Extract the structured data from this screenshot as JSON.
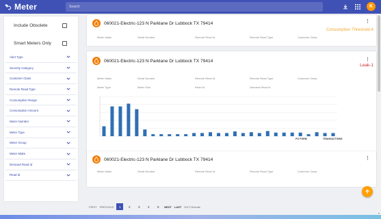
{
  "app": {
    "title": "Meter"
  },
  "search": {
    "placeholder": "Search"
  },
  "header": {
    "avatar_letter": "K"
  },
  "sidebar": {
    "checkboxes": [
      {
        "label": "Include Obsolete",
        "checked": false
      },
      {
        "label": "Smart Meters Only",
        "checked": false
      }
    ],
    "filters": [
      "Alert Type",
      "Severity Category",
      "Customer Class",
      "Remote Read Type",
      "Consumption Range",
      "Consumption Amount",
      "Meter Number",
      "Meter Type",
      "Meter Group",
      "Meter Make",
      "Demand Read Id",
      "Read Id"
    ]
  },
  "cards": [
    {
      "title": "060021-Electric-123 N Parklane Dr Lubbock TX 79414",
      "status": "Consumption Threshold-4",
      "status_color": "#f0a830",
      "fields_row1": [
        "Meter Make",
        "Serial Number",
        "Remote Read Id",
        "Remote Read Type",
        "Customer Class"
      ]
    },
    {
      "title": "060021-Electric-123 N Parklane Dr Lubbock TX 79414",
      "status": "Leak-1",
      "status_color": "#c62828",
      "fields_row1": [
        "Meter Make",
        "Serial Number",
        "Remote Read Id",
        "Remote Read Type",
        "Customer Class"
      ],
      "fields_row2": [
        "Meter Type",
        "Meter Size",
        "Read Id",
        "Demand Read Id"
      ],
      "chart_links": [
        "PO FORM",
        "TRANSACTIONS"
      ]
    },
    {
      "title": "060021-Electric-123 N Parklane Dr Lubbock TX 79414",
      "fields_row1": [
        "Meter Make",
        "Serial Number",
        "Remote Read Id",
        "Remote Read Type",
        "Customer Class"
      ]
    }
  ],
  "chart_data": {
    "type": "bar",
    "title": "",
    "xlabel": "",
    "ylabel": "",
    "color": "#2f6fb5",
    "ylim": [
      0,
      10
    ],
    "grid": true,
    "values": [
      2.5,
      7.5,
      7.5,
      8.2,
      6.8,
      1.7,
      0.5,
      0.5,
      0.5,
      0.5,
      0.5,
      0.8,
      0.8,
      1.0,
      0.8,
      0.8,
      1.2,
      0.8,
      1.0,
      0.8,
      1.3,
      0.9,
      0.9,
      0.9,
      0.9,
      0.5,
      1.0,
      0.8,
      0.8
    ]
  },
  "pagination": {
    "first": "FIRST",
    "previous": "PREVIOUS",
    "pages": [
      "1",
      "2",
      "3",
      "4",
      "5"
    ],
    "active": "1",
    "next": "NEXT",
    "last": "LAST",
    "results": "5471 Results"
  },
  "colors": {
    "primary": "#3f51b5",
    "accent": "#ffa000",
    "drop": "#f57c00"
  }
}
